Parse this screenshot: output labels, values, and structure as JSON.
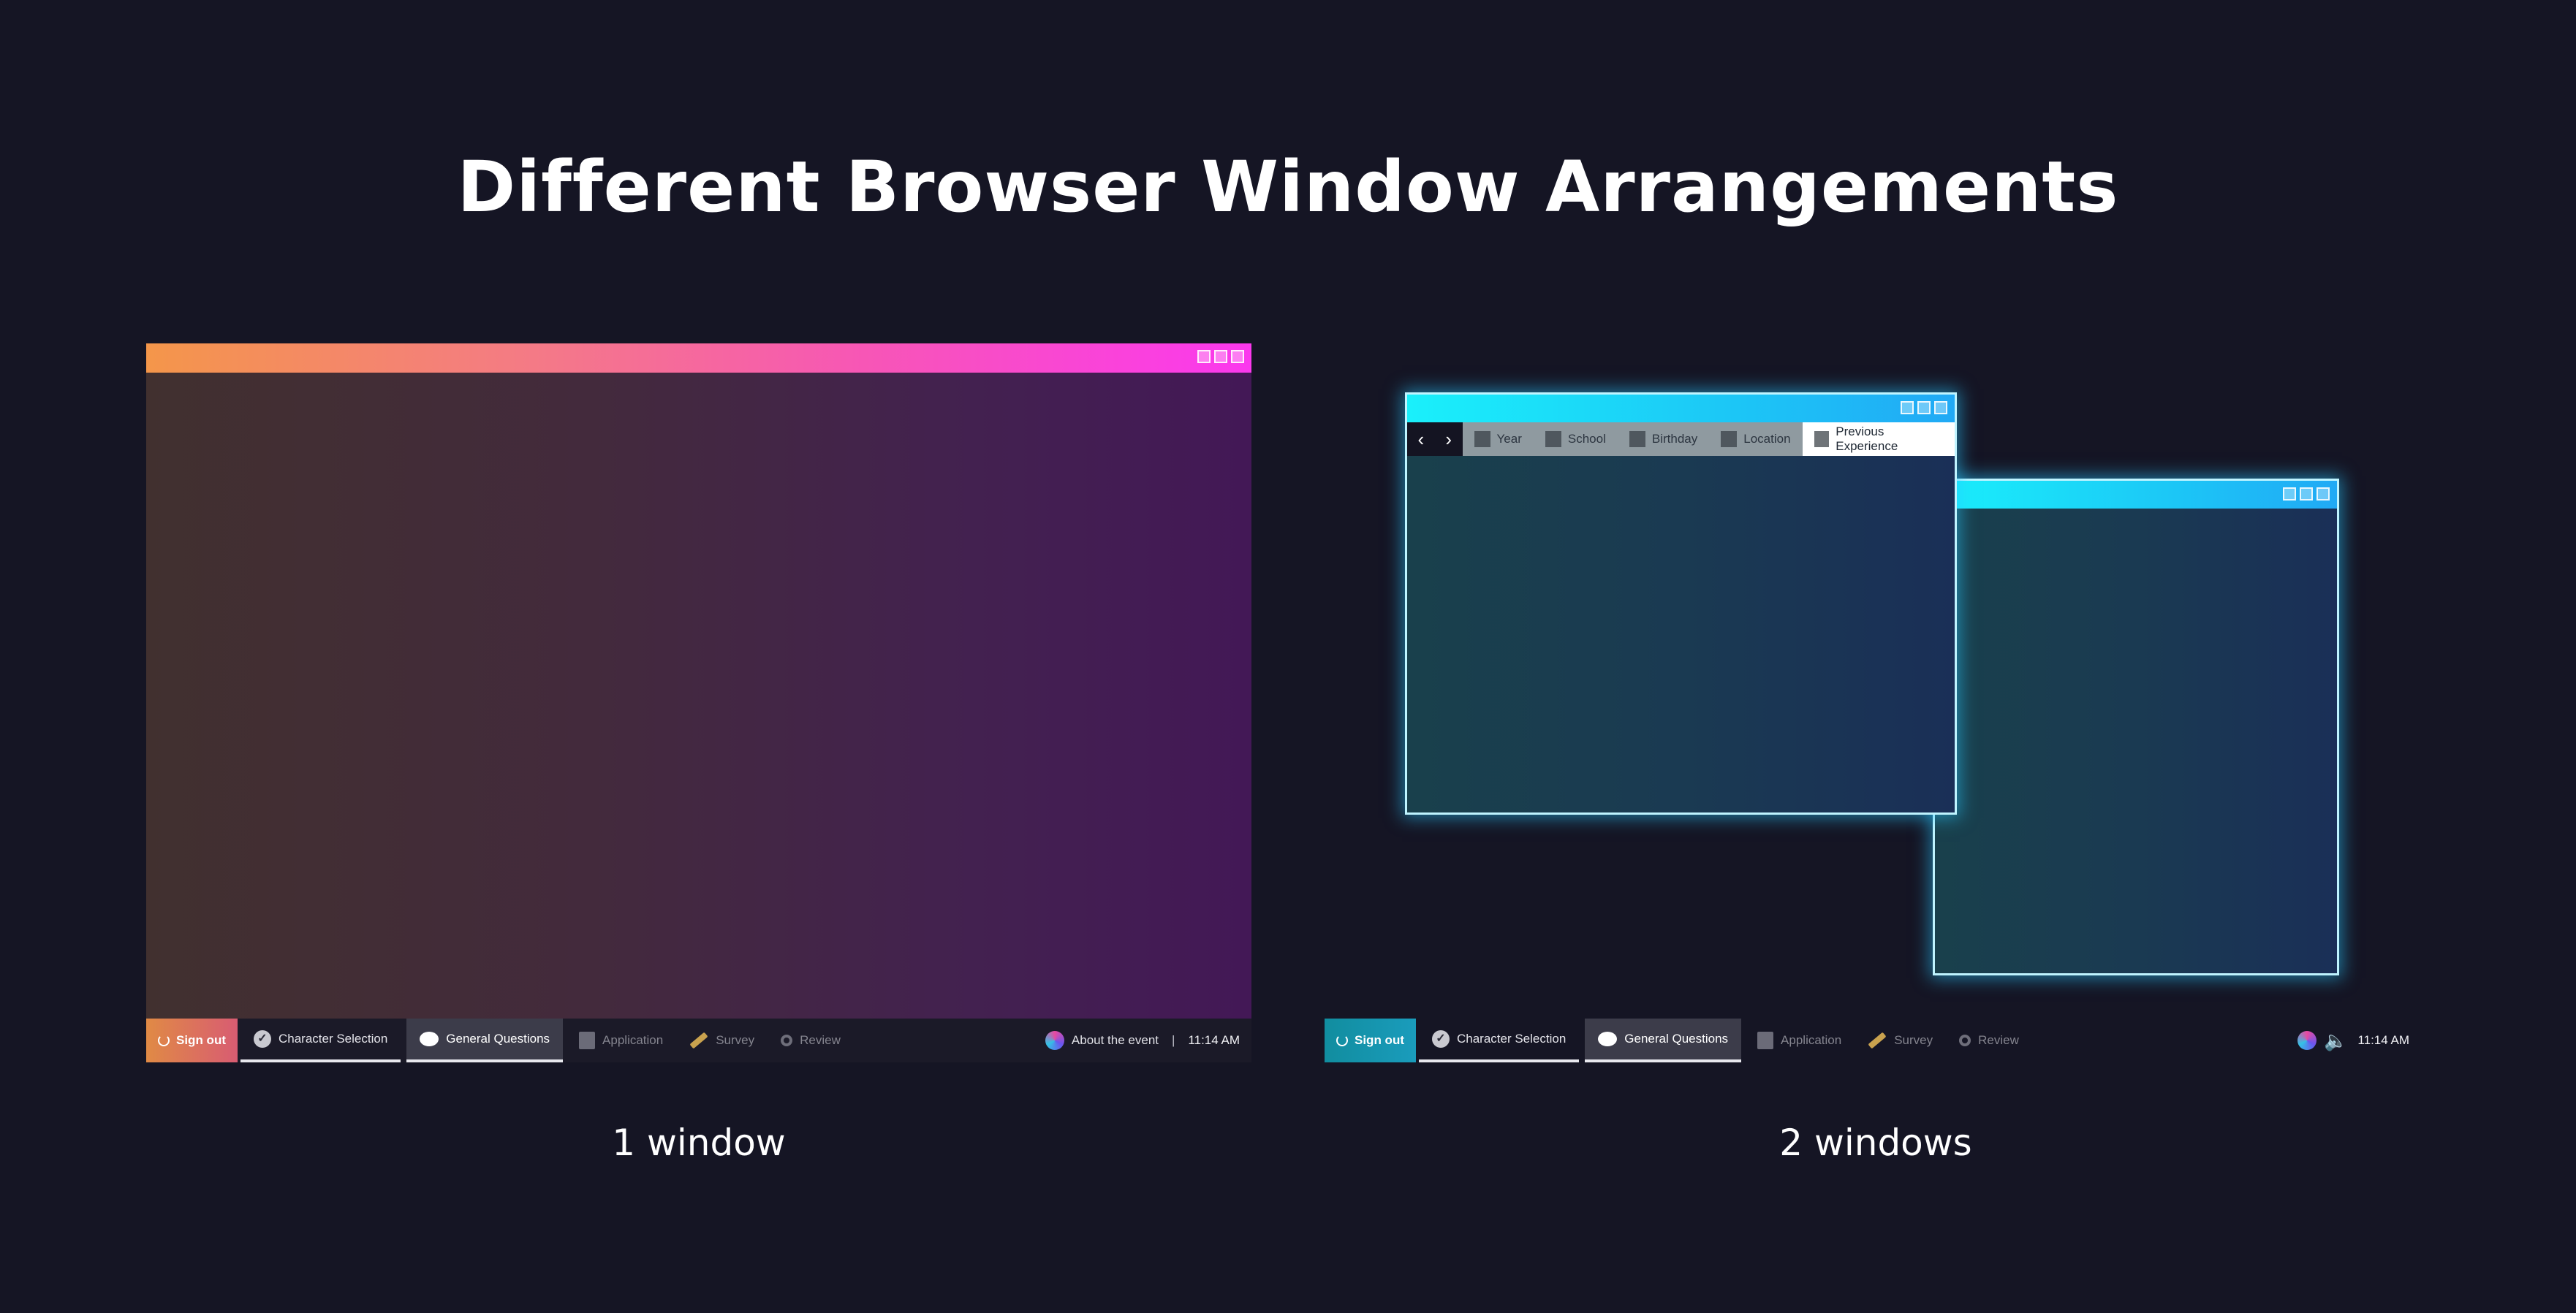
{
  "title": "Different Browser Window Arrangements",
  "captions": {
    "one": "1 window",
    "two": "2 windows"
  },
  "window_controls": [
    "minimize-icon",
    "maximize-icon",
    "close-icon"
  ],
  "colors": {
    "background": "#151524",
    "warm_bar_start": "#f4964a",
    "warm_bar_end": "#fb38ee",
    "cyan_bar_start": "#1af0fb",
    "cyan_bar_end": "#21a9f5",
    "cyan_border": "#bff4ff"
  },
  "tabs": {
    "nav_back": "‹",
    "nav_forward": "›",
    "items": [
      "Year",
      "School",
      "Birthday",
      "Location"
    ],
    "active": "Previous Experience"
  },
  "taskbar1": {
    "signout": "Sign out",
    "steps": [
      {
        "label": "Character Selection",
        "icon": "check-icon",
        "state": "done"
      },
      {
        "label": "General Questions",
        "icon": "speech-bubble-icon",
        "state": "current"
      },
      {
        "label": "Application",
        "icon": "document-icon",
        "state": "upcoming"
      },
      {
        "label": "Survey",
        "icon": "pencil-icon",
        "state": "upcoming"
      },
      {
        "label": "Review",
        "icon": "magnifier-icon",
        "state": "upcoming"
      }
    ],
    "about": "About the event",
    "separator": "|",
    "time": "11:14 AM"
  },
  "taskbar2": {
    "signout": "Sign out",
    "steps": [
      {
        "label": "Character Selection",
        "icon": "check-icon",
        "state": "done"
      },
      {
        "label": "General Questions",
        "icon": "speech-bubble-icon",
        "state": "current"
      },
      {
        "label": "Application",
        "icon": "document-icon",
        "state": "upcoming"
      },
      {
        "label": "Survey",
        "icon": "pencil-icon",
        "state": "upcoming"
      },
      {
        "label": "Review",
        "icon": "magnifier-icon",
        "state": "upcoming"
      }
    ],
    "speaker_icon": "speaker-icon",
    "time": "11:14 AM"
  }
}
